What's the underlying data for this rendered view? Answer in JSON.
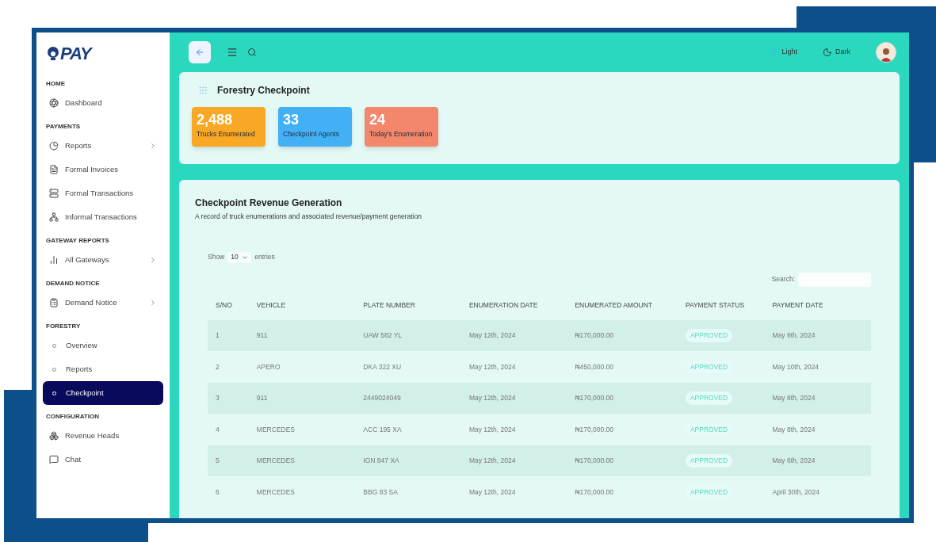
{
  "logo": {
    "text": "PAY"
  },
  "sidebar": {
    "sections": [
      {
        "title": "HOME",
        "items": [
          {
            "label": "Dashboard",
            "kind": "icon",
            "has_submenu": false,
            "selected": false
          }
        ]
      },
      {
        "title": "PAYMENTS",
        "items": [
          {
            "label": "Reports",
            "kind": "icon",
            "has_submenu": true,
            "selected": false
          },
          {
            "label": "Formal Invoices",
            "kind": "icon",
            "has_submenu": false,
            "selected": false
          },
          {
            "label": "Formal Transactions",
            "kind": "icon",
            "has_submenu": false,
            "selected": false
          },
          {
            "label": "Informal Transactions",
            "kind": "icon",
            "has_submenu": false,
            "selected": false
          }
        ]
      },
      {
        "title": "GATEWAY REPORTS",
        "items": [
          {
            "label": "All Gateways",
            "kind": "icon",
            "has_submenu": true,
            "selected": false
          }
        ]
      },
      {
        "title": "DEMAND NOTICE",
        "items": [
          {
            "label": "Demand Notice",
            "kind": "icon",
            "has_submenu": true,
            "selected": false
          }
        ]
      },
      {
        "title": "FORESTRY",
        "items": [
          {
            "label": "Overview",
            "kind": "dot",
            "has_submenu": false,
            "selected": false
          },
          {
            "label": "Reports",
            "kind": "dot",
            "has_submenu": false,
            "selected": false
          },
          {
            "label": "Checkpoint",
            "kind": "dot",
            "has_submenu": false,
            "selected": true
          }
        ]
      },
      {
        "title": "CONFIGURATION",
        "items": [
          {
            "label": "Revenue Heads",
            "kind": "icon",
            "has_submenu": false,
            "selected": false
          },
          {
            "label": "Chat",
            "kind": "icon",
            "has_submenu": false,
            "selected": false
          }
        ]
      }
    ]
  },
  "topbar": {
    "light_label": "Light",
    "dark_label": "Dark"
  },
  "overview": {
    "title": "Forestry Checkpoint",
    "stats": [
      {
        "value": "2,488",
        "label": "Trucks Enumerated",
        "color": "#f9a825"
      },
      {
        "value": "33",
        "label": "Checkpoint Agents",
        "color": "#42b0f5"
      },
      {
        "value": "24",
        "label": "Today's Enumeration",
        "color": "#f2876b"
      }
    ]
  },
  "table_card": {
    "title": "Checkpoint Revenue Generation",
    "subtitle": "A record of truck enumerations and associated revenue/payment generation",
    "show_label": "Show",
    "page_size": "10",
    "entries_label": "entries",
    "search_label": "Search:",
    "columns": [
      "S/NO",
      "VEHICLE",
      "PLATE NUMBER",
      "ENUMERATION DATE",
      "ENUMERATED AMOUNT",
      "PAYMENT STATUS",
      "PAYMENT DATE"
    ],
    "rows": [
      {
        "sno": "1",
        "vehicle": "911",
        "plate": "UAW 582 YL",
        "enum_date": "May 12th, 2024",
        "amount": "₦170,000.00",
        "status": "APPROVED",
        "pay_date": "May 9th, 2024"
      },
      {
        "sno": "2",
        "vehicle": "APERO",
        "plate": "DKA 322 XU",
        "enum_date": "May 12th, 2024",
        "amount": "₦450,000.00",
        "status": "APPROVED",
        "pay_date": "May 10th, 2024"
      },
      {
        "sno": "3",
        "vehicle": "911",
        "plate": "2449024049",
        "enum_date": "May 12th, 2024",
        "amount": "₦170,000.00",
        "status": "APPROVED",
        "pay_date": "May 8th, 2024"
      },
      {
        "sno": "4",
        "vehicle": "MERCEDES",
        "plate": "ACC 195 XA",
        "enum_date": "May 12th, 2024",
        "amount": "₦170,000.00",
        "status": "APPROVED",
        "pay_date": "May 8th, 2024"
      },
      {
        "sno": "5",
        "vehicle": "MERCEDES",
        "plate": "IGN 847 XA",
        "enum_date": "May 12th, 2024",
        "amount": "₦170,000.00",
        "status": "APPROVED",
        "pay_date": "May 6th, 2024"
      },
      {
        "sno": "6",
        "vehicle": "MERCEDES",
        "plate": "BBG 83 SA",
        "enum_date": "May 12th, 2024",
        "amount": "₦170,000.00",
        "status": "APPROVED",
        "pay_date": "April 30th, 2024"
      }
    ]
  }
}
